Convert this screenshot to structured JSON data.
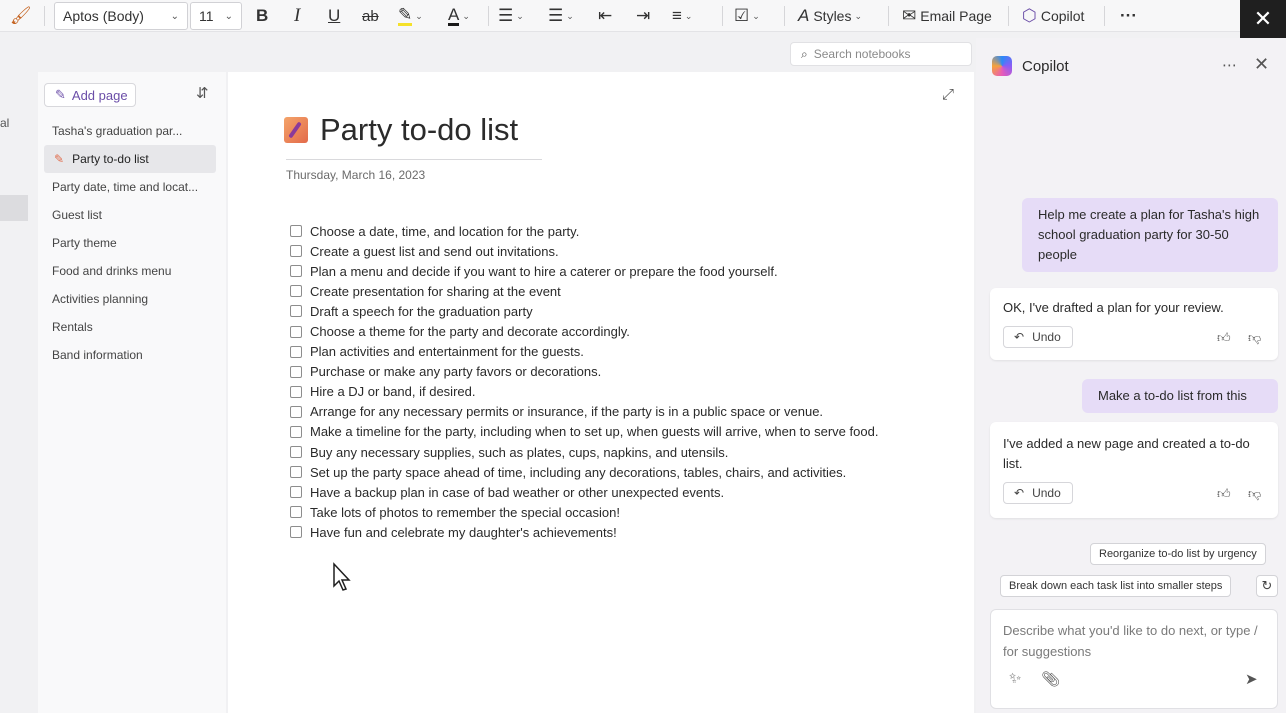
{
  "toolbar": {
    "font_family": "Aptos (Body)",
    "font_size": "11",
    "styles_label": "Styles",
    "email_label": "Email Page",
    "copilot_label": "Copilot",
    "more_label": "···"
  },
  "left_edge": {
    "cut_text": "al"
  },
  "search": {
    "placeholder": "Search notebooks"
  },
  "nav": {
    "add_page_label": "Add page",
    "items": [
      {
        "label": "Tasha's graduation par..."
      },
      {
        "label": "Party to-do list"
      },
      {
        "label": "Party date, time and locat..."
      },
      {
        "label": "Guest list"
      },
      {
        "label": "Party theme"
      },
      {
        "label": "Food and drinks menu"
      },
      {
        "label": "Activities planning"
      },
      {
        "label": "Rentals"
      },
      {
        "label": "Band information"
      }
    ]
  },
  "page": {
    "title": "Party to-do list",
    "date": "Thursday, March 16, 2023",
    "todos": [
      "Choose a date, time, and location for the party.",
      "Create a guest list and send out invitations.",
      "Plan a menu and decide if you want to hire a caterer or prepare the food yourself.",
      "Create presentation for sharing at the event",
      "Draft a speech for the graduation party",
      "Choose a theme for the party and decorate accordingly.",
      "Plan activities and entertainment for the guests.",
      "Purchase or make any party favors or decorations.",
      "Hire a DJ or band, if desired.",
      "Arrange for any necessary permits or insurance, if the party is in a public space or venue.",
      "Make a timeline for the party, including when to set up, when guests will arrive, when to serve food.",
      "Buy any necessary supplies, such as plates, cups, napkins, and utensils.",
      "Set up the party space ahead of time, including any decorations, tables, chairs, and activities.",
      "Have a backup plan in case of bad weather or other unexpected events.",
      "Take lots of photos to remember the special occasion!",
      "Have fun and celebrate my daughter's achievements!"
    ]
  },
  "copilot": {
    "title": "Copilot",
    "messages": {
      "user1": "Help me create a plan for Tasha's high school graduation party for 30-50 people",
      "ai1": "OK, I've drafted a plan for your review.",
      "user2": "Make a to-do list from this",
      "ai2": "I've added a new page and created a to-do list."
    },
    "undo_label": "Undo",
    "suggestions": [
      "Reorganize to-do list by urgency",
      "Break down each task list into smaller steps"
    ],
    "composer_placeholder": "Describe what you'd like to do next, or type / for suggestions"
  },
  "colors": {
    "accent": "#6b4ea8",
    "user_bubble": "#e6dcf7",
    "close_bar": "#1f1f1f"
  }
}
